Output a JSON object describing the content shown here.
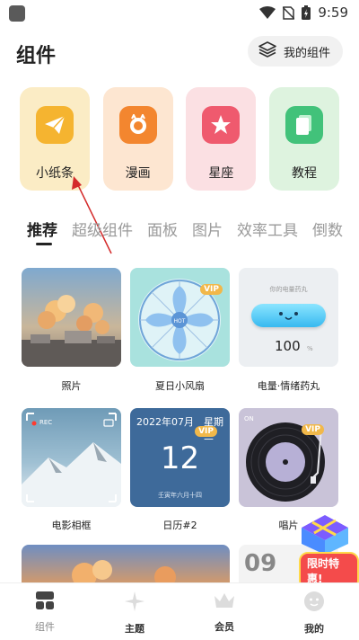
{
  "status_bar": {
    "time": "9:59"
  },
  "header": {
    "title": "组件",
    "my_widgets_label": "我的组件"
  },
  "shortcuts": [
    {
      "label": "小纸条",
      "icon": "paper-plane-icon",
      "bg": "#fbecc5",
      "icon_bg": "#f5b430"
    },
    {
      "label": "漫画",
      "icon": "comic-icon",
      "bg": "#fde6d1",
      "icon_bg": "#f3862f"
    },
    {
      "label": "星座",
      "icon": "star-icon",
      "bg": "#fbe0e3",
      "icon_bg": "#ef5a6e"
    },
    {
      "label": "教程",
      "icon": "document-icon",
      "bg": "#def3df",
      "icon_bg": "#42c27a"
    }
  ],
  "category_tabs": [
    "推荐",
    "超级组件",
    "面板",
    "图片",
    "效率工具",
    "倒数"
  ],
  "widget_cards": [
    {
      "label": "照片"
    },
    {
      "label": "夏日小风扇",
      "badge": "VIP",
      "fan_center": "HOT"
    },
    {
      "label": "电量·情绪药丸",
      "pill_title": "你的电量药丸",
      "percent_value": "100",
      "percent_unit": "%"
    },
    {
      "label": "电影相框",
      "rec_label": "REC"
    },
    {
      "label": "日历#2",
      "badge": "VIP",
      "month": "2022年07月",
      "weekday": "星期二",
      "day": "12",
      "lunar": "壬寅年六月十四"
    },
    {
      "label": "唱片",
      "badge": "VIP",
      "on_label": "ON"
    }
  ],
  "partial_cards": {
    "clock_digits": "09"
  },
  "promo": {
    "label": "限时特惠!"
  },
  "bottom_nav": [
    {
      "label": "组件",
      "icon": "widgets-icon"
    },
    {
      "label": "主题",
      "icon": "sparkle-icon"
    },
    {
      "label": "会员",
      "icon": "crown-icon"
    },
    {
      "label": "我的",
      "icon": "profile-icon"
    }
  ]
}
